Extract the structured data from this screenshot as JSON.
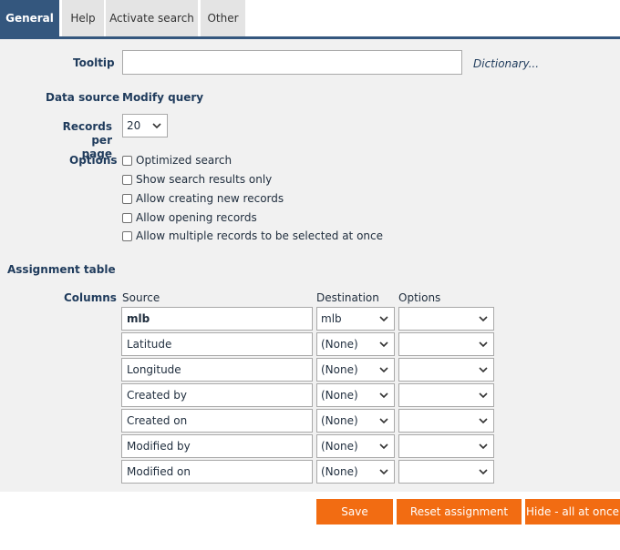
{
  "tabs": [
    {
      "label": "General"
    },
    {
      "label": "Help"
    },
    {
      "label": "Activate search"
    },
    {
      "label": "Other"
    }
  ],
  "form": {
    "tooltip_label": "Tooltip",
    "tooltip_value": "",
    "dictionary_link": "Dictionary...",
    "datasource_label": "Data source",
    "datasource_value": "Modify query",
    "records_label_line1": "Records per",
    "records_label_line2": "page",
    "records_value": "20",
    "options_label": "Options",
    "options": [
      {
        "label": "Optimized search",
        "checked": false
      },
      {
        "label": "Show search results only",
        "checked": false
      },
      {
        "label": "Allow creating new records",
        "checked": false
      },
      {
        "label": "Allow opening records",
        "checked": false
      },
      {
        "label": "Allow multiple records to be selected at once",
        "checked": false
      }
    ]
  },
  "assignment": {
    "title": "Assignment table",
    "columns_label": "Columns",
    "headers": {
      "source": "Source",
      "destination": "Destination",
      "options": "Options"
    },
    "rows": [
      {
        "source": "mlb",
        "destination": "mlb",
        "options": ""
      },
      {
        "source": "Latitude",
        "destination": "(None)",
        "options": ""
      },
      {
        "source": "Longitude",
        "destination": "(None)",
        "options": ""
      },
      {
        "source": "Created by",
        "destination": "(None)",
        "options": ""
      },
      {
        "source": "Created on",
        "destination": "(None)",
        "options": ""
      },
      {
        "source": "Modified by",
        "destination": "(None)",
        "options": ""
      },
      {
        "source": "Modified on",
        "destination": "(None)",
        "options": ""
      }
    ]
  },
  "buttons": {
    "save": "Save",
    "reset": "Reset assignment table",
    "hide": "Hide - all at once"
  },
  "colors": {
    "accent": "#34577e",
    "button": "#f26c12",
    "panel": "#f1f1f1"
  }
}
